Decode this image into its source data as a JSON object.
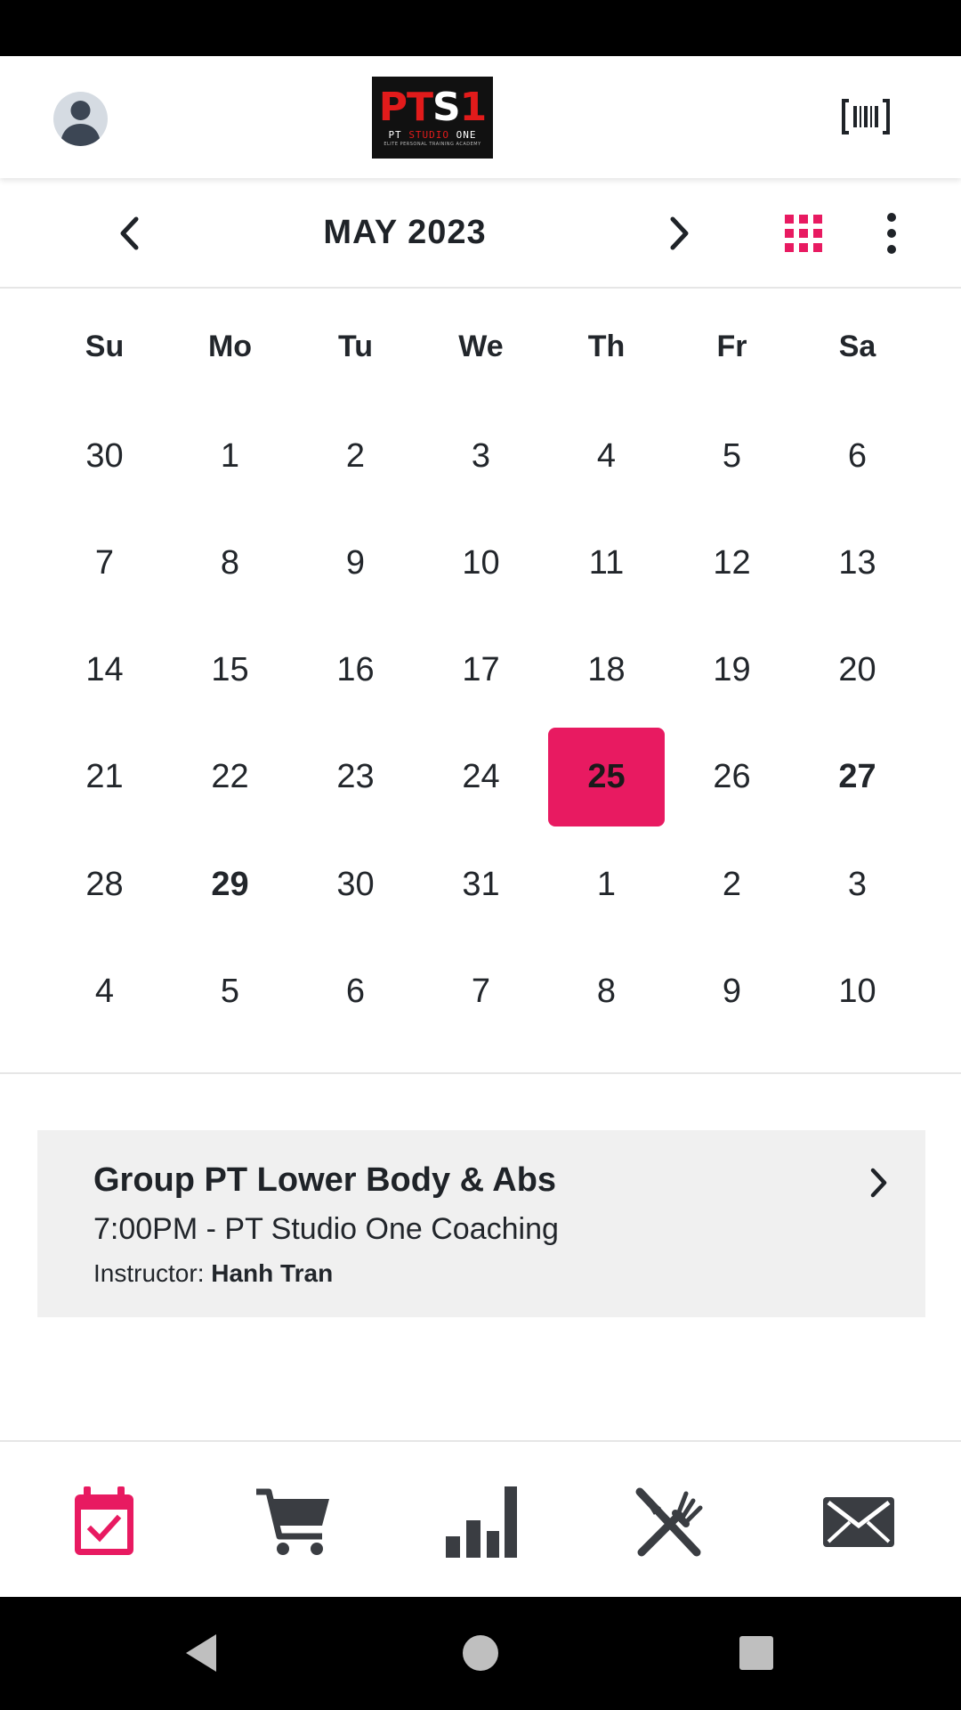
{
  "calendar": {
    "month_label": "MAY 2023",
    "weekdays": [
      "Su",
      "Mo",
      "Tu",
      "We",
      "Th",
      "Fr",
      "Sa"
    ],
    "weeks": [
      [
        "30",
        "1",
        "2",
        "3",
        "4",
        "5",
        "6"
      ],
      [
        "7",
        "8",
        "9",
        "10",
        "11",
        "12",
        "13"
      ],
      [
        "14",
        "15",
        "16",
        "17",
        "18",
        "19",
        "20"
      ],
      [
        "21",
        "22",
        "23",
        "24",
        "25",
        "26",
        "27"
      ],
      [
        "28",
        "29",
        "30",
        "31",
        "1",
        "2",
        "3"
      ],
      [
        "4",
        "5",
        "6",
        "7",
        "8",
        "9",
        "10"
      ]
    ],
    "selected_day": "25",
    "days_with_events": [
      "27",
      "29"
    ]
  },
  "logo": {
    "mark_red": "PT",
    "mark_white": "S",
    "mark_red2": "1",
    "sub_white": "PT ",
    "sub_red": "STUDIO",
    "sub_white2": " ONE",
    "tagline": "ELITE PERSONAL TRAINING ACADEMY"
  },
  "event": {
    "title": "Group PT Lower Body & Abs",
    "time": "7:00PM - PT Studio One Coaching",
    "instructor_label": "Instructor:",
    "instructor_name": "Hanh Tran"
  },
  "bottom_nav": [
    "calendar-icon",
    "cart-icon",
    "stats-icon",
    "nutrition-icon",
    "mail-icon"
  ],
  "colors": {
    "accent": "#e81a61",
    "icon": "#3a3d42"
  }
}
